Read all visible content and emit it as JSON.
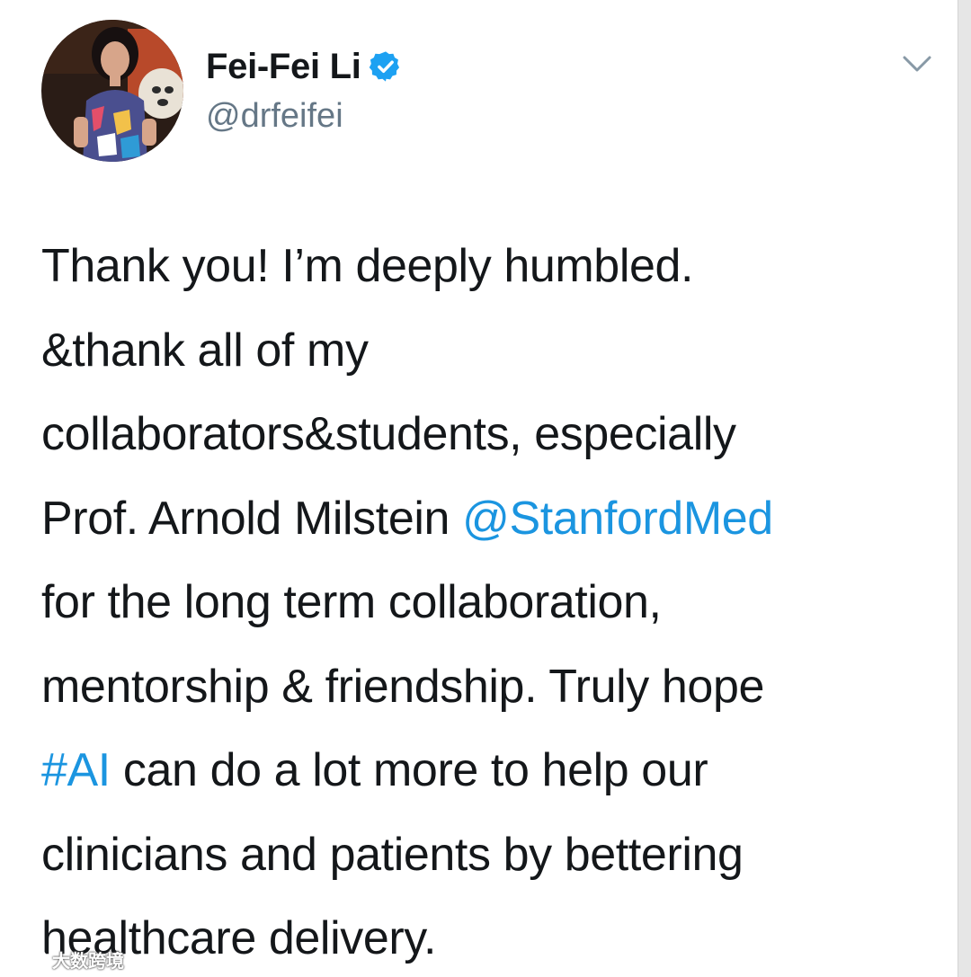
{
  "author": {
    "display_name": "Fei-Fei Li",
    "handle": "@drfeifei",
    "verified": true,
    "avatar_icon": "profile-photo"
  },
  "menu": {
    "icon": "chevron-down-icon"
  },
  "tweet": {
    "line1": "Thank you! I’m deeply humbled.",
    "line2": "&thank all of my",
    "line3": "collaborators&students, especially",
    "line4_text": "Prof. Arnold Milstein ",
    "line4_mention": "@StanfordMed",
    "line5": "for the long term collaboration,",
    "line6": "mentorship & friendship. Truly hope",
    "line7_hashtag": "#AI",
    "line7_text": " can do a lot more to help our",
    "line8": "clinicians and patients by bettering",
    "line9": "healthcare delivery."
  },
  "watermark": {
    "text": "大数跨境"
  },
  "colors": {
    "text": "#14171a",
    "secondary": "#657786",
    "link": "#1b95e0",
    "verified": "#1da1f2"
  }
}
